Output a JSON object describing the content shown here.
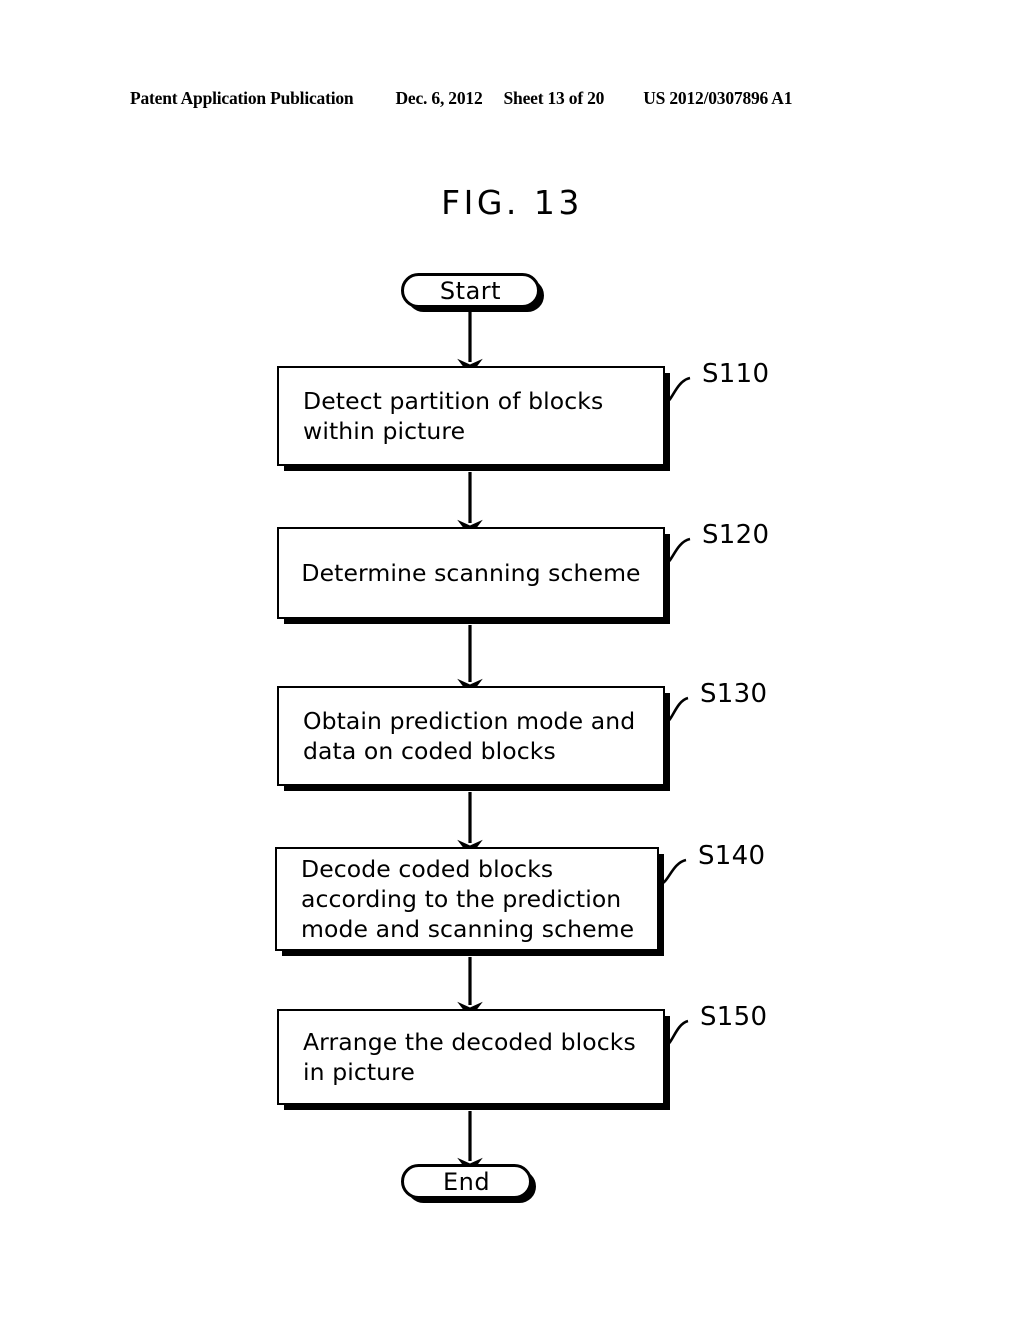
{
  "page": {
    "background_color": "#ffffff",
    "ink_color": "#000000"
  },
  "header": {
    "publication": "Patent Application Publication",
    "date": "Dec. 6, 2012",
    "sheet": "Sheet 13 of 20",
    "document_number": "US 2012/0307896 A1"
  },
  "figure": {
    "title": "FIG. 13"
  },
  "flowchart": {
    "start_label": "Start",
    "end_label": "End",
    "steps": [
      {
        "ref": "S110",
        "text": "Detect partition of blocks\nwithin picture",
        "align": "left"
      },
      {
        "ref": "S120",
        "text": "Determine scanning scheme",
        "align": "center"
      },
      {
        "ref": "S130",
        "text": "Obtain prediction mode and\ndata on coded blocks",
        "align": "left"
      },
      {
        "ref": "S140",
        "text": "Decode coded blocks\naccording to the prediction\nmode and scanning scheme",
        "align": "left"
      },
      {
        "ref": "S150",
        "text": "Arrange the decoded blocks\nin picture",
        "align": "left"
      }
    ]
  }
}
